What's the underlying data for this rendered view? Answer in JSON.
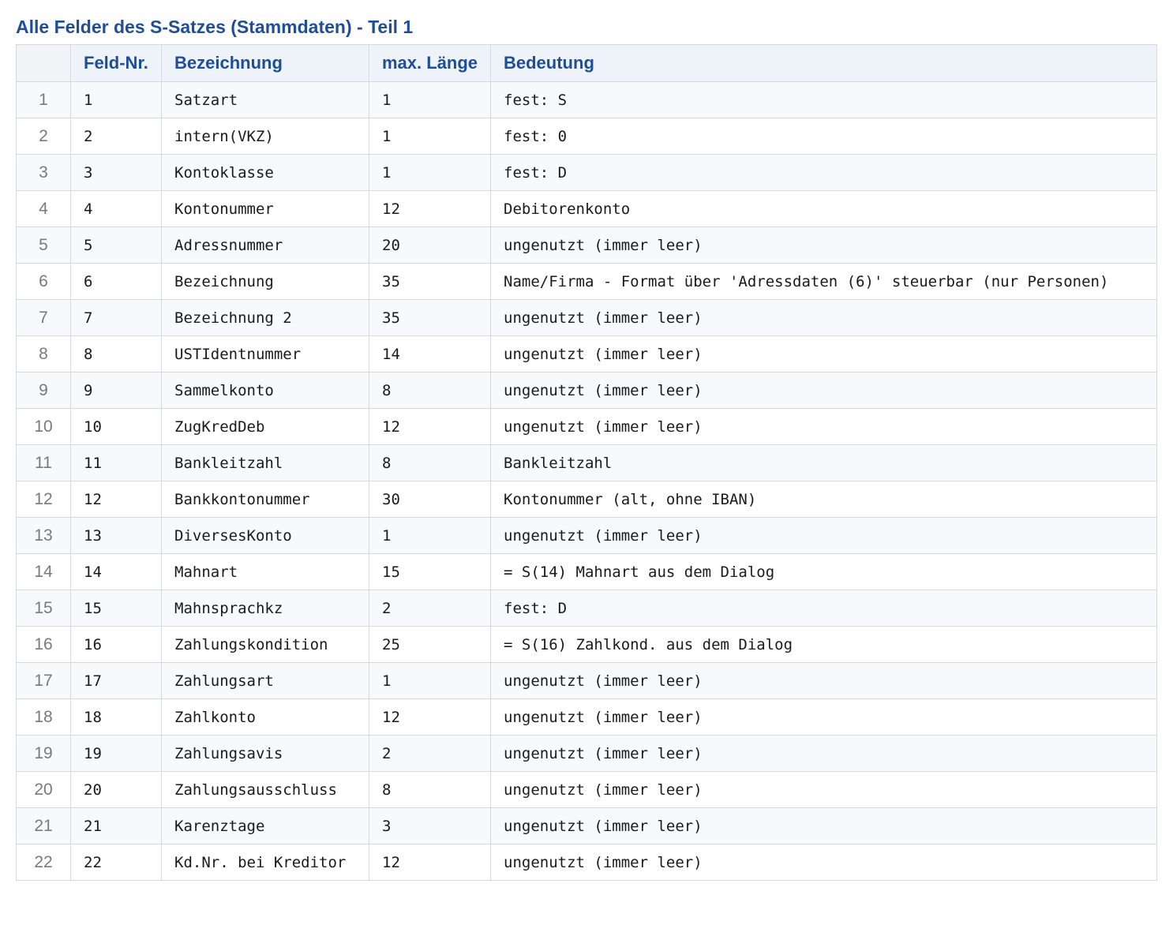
{
  "title": "Alle Felder des S-Satzes (Stammdaten) - Teil 1",
  "table": {
    "headers": [
      "",
      "Feld-Nr.",
      "Bezeichnung",
      "max. Länge",
      "Bedeutung"
    ],
    "rows": [
      {
        "idx": "1",
        "nr": "1",
        "bez": "Satzart",
        "len": "1",
        "bed": "fest: S"
      },
      {
        "idx": "2",
        "nr": "2",
        "bez": "intern(VKZ)",
        "len": "1",
        "bed": "fest: 0"
      },
      {
        "idx": "3",
        "nr": "3",
        "bez": "Kontoklasse",
        "len": "1",
        "bed": "fest: D"
      },
      {
        "idx": "4",
        "nr": "4",
        "bez": "Kontonummer",
        "len": "12",
        "bed": "Debitorenkonto"
      },
      {
        "idx": "5",
        "nr": "5",
        "bez": "Adressnummer",
        "len": "20",
        "bed": "ungenutzt (immer leer)"
      },
      {
        "idx": "6",
        "nr": "6",
        "bez": "Bezeichnung",
        "len": "35",
        "bed": "Name/Firma - Format über 'Adressdaten (6)' steuerbar (nur Personen)"
      },
      {
        "idx": "7",
        "nr": "7",
        "bez": "Bezeichnung 2",
        "len": "35",
        "bed": "ungenutzt (immer leer)"
      },
      {
        "idx": "8",
        "nr": "8",
        "bez": "USTIdentnummer",
        "len": "14",
        "bed": "ungenutzt (immer leer)"
      },
      {
        "idx": "9",
        "nr": "9",
        "bez": "Sammelkonto",
        "len": "8",
        "bed": "ungenutzt (immer leer)"
      },
      {
        "idx": "10",
        "nr": "10",
        "bez": "ZugKredDeb",
        "len": "12",
        "bed": "ungenutzt (immer leer)"
      },
      {
        "idx": "11",
        "nr": "11",
        "bez": "Bankleitzahl",
        "len": "8",
        "bed": "Bankleitzahl"
      },
      {
        "idx": "12",
        "nr": "12",
        "bez": "Bankkontonummer",
        "len": "30",
        "bed": "Kontonummer (alt, ohne IBAN)"
      },
      {
        "idx": "13",
        "nr": "13",
        "bez": "DiversesKonto",
        "len": "1",
        "bed": "ungenutzt (immer leer)"
      },
      {
        "idx": "14",
        "nr": "14",
        "bez": "Mahnart",
        "len": "15",
        "bed": "= S(14) Mahnart aus dem Dialog"
      },
      {
        "idx": "15",
        "nr": "15",
        "bez": "Mahnsprachkz",
        "len": "2",
        "bed": "fest: D"
      },
      {
        "idx": "16",
        "nr": "16",
        "bez": "Zahlungskondition",
        "len": "25",
        "bed": "= S(16) Zahlkond. aus dem Dialog"
      },
      {
        "idx": "17",
        "nr": "17",
        "bez": "Zahlungsart",
        "len": "1",
        "bed": "ungenutzt (immer leer)"
      },
      {
        "idx": "18",
        "nr": "18",
        "bez": "Zahlkonto",
        "len": "12",
        "bed": "ungenutzt (immer leer)"
      },
      {
        "idx": "19",
        "nr": "19",
        "bez": "Zahlungsavis",
        "len": "2",
        "bed": "ungenutzt (immer leer)"
      },
      {
        "idx": "20",
        "nr": "20",
        "bez": "Zahlungsausschluss",
        "len": "8",
        "bed": "ungenutzt (immer leer)"
      },
      {
        "idx": "21",
        "nr": "21",
        "bez": "Karenztage",
        "len": "3",
        "bed": "ungenutzt (immer leer)"
      },
      {
        "idx": "22",
        "nr": "22",
        "bez": "Kd.Nr. bei Kreditor",
        "len": "12",
        "bed": "ungenutzt (immer leer)"
      }
    ]
  },
  "colors": {
    "title": "#1f4e99",
    "header_text": "#1f4e99",
    "header_bg": "#eef2f9",
    "row_odd_bg": "#f7f9fd",
    "row_even_bg": "#ffffff",
    "border": "#d5d8de",
    "index_text": "#7a7a7a"
  }
}
